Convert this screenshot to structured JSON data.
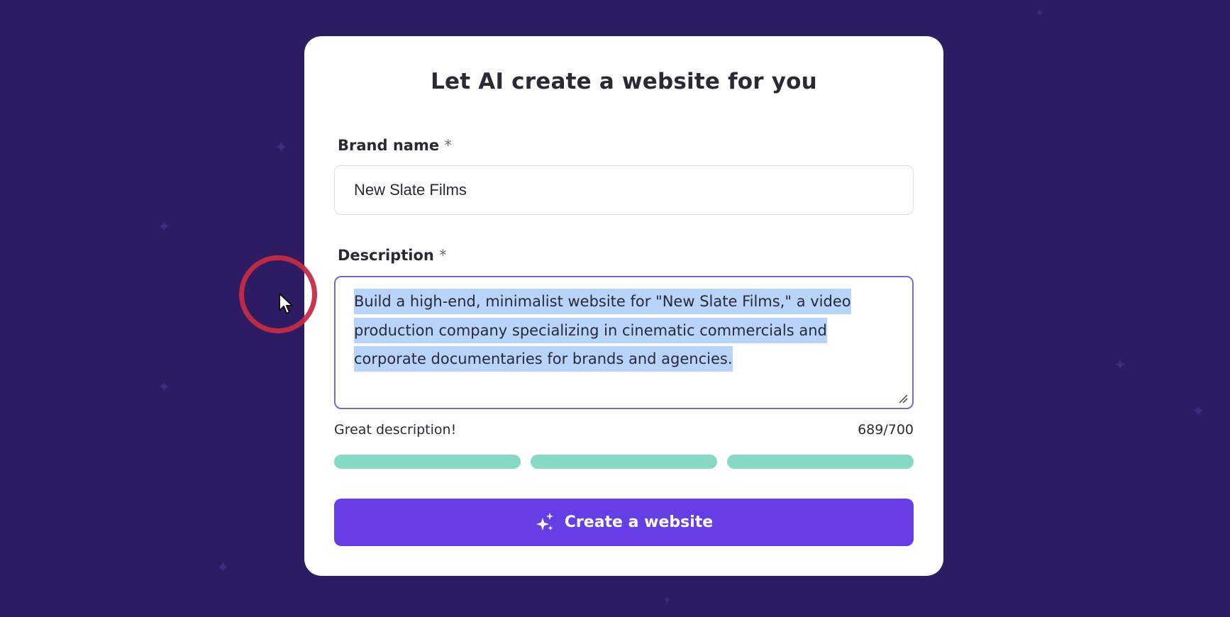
{
  "page": {
    "title": "Let AI create a website for you"
  },
  "brand": {
    "label": "Brand name",
    "required_mark": "*",
    "value": "New Slate Films"
  },
  "description": {
    "label": "Description",
    "required_mark": "*",
    "value": "Build a high-end, minimalist website for \"New Slate Films,\" a video production company specializing in cinematic commercials and corporate documentaries for brands and agencies.",
    "selected": true
  },
  "quality": {
    "feedback": "Great description!",
    "counter": "689/700",
    "bars_filled": 3,
    "bars_total": 3,
    "bar_color": "#86d8c7"
  },
  "action": {
    "label": "Create a website",
    "icon": "sparkles-icon",
    "color": "#673de6"
  },
  "colors": {
    "background": "#2d1b64",
    "card": "#ffffff",
    "focus_border": "#7a66d6",
    "selection": "#b8d4fb",
    "click_ring": "#c42b45"
  }
}
